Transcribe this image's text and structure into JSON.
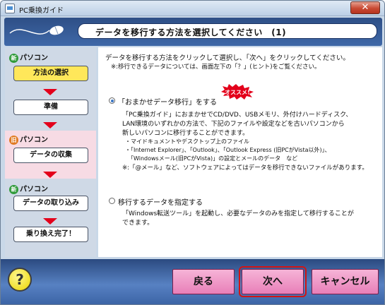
{
  "window": {
    "title": "PC乗換ガイド",
    "close_label": "✕"
  },
  "header": {
    "banner": "データを移行する方法を選択してください　(1)"
  },
  "sidebar": {
    "new_pc_label": "パソコン",
    "new_badge": "新",
    "old_pc_label": "パソコン",
    "old_badge": "旧",
    "steps": [
      {
        "label": "方法の選択",
        "active": true
      },
      {
        "label": "準備"
      },
      {
        "label": "データの収集"
      },
      {
        "label": "データの取り込み"
      },
      {
        "label": "乗り換え完了！"
      }
    ]
  },
  "main": {
    "intro1": "データを移行する方法をクリックして選択し、「次へ」をクリックしてください。",
    "intro2": "※:移行できるデータについては、画面左下の「？」(ヒント)をご覧ください。",
    "option1": {
      "label": "「おまかせデータ移行」をする",
      "badge": "オススメ!",
      "selected": true,
      "desc1": "「PC乗換ガイド」におまかせでCD/DVD、USBメモリ、外付けハードディスク、",
      "desc2": "LAN環境のいずれかの方法で、下記のファイルや設定などを古いパソコンから",
      "desc3": "新しいパソコンに移行することができます。",
      "item1": "・マイドキュメントやデスクトップ上のファイル",
      "item2": "・「Internet Explorer」、「Outlook」、「Outlook Express (旧PCがVista以外)」、",
      "item3": "　「Windowsメール(旧PCがVista)」の設定とメールのデータ　など",
      "note": "※:「@メール」など、ソフトウェアによってはデータを移行できないファイルがあります。"
    },
    "option2": {
      "label": "移行するデータを指定する",
      "selected": false,
      "desc1": "「Windows転送ツール」を起動し、必要なデータのみを指定して移行することが",
      "desc2": "できます。"
    }
  },
  "footer": {
    "help": "?",
    "back": "戻る",
    "next": "次へ",
    "cancel": "キャンセル"
  },
  "colors": {
    "accent_red": "#e3001b",
    "active_step": "#ffe75a",
    "button_pink": "#e87fb8",
    "header_blue": "#2e4f86"
  }
}
